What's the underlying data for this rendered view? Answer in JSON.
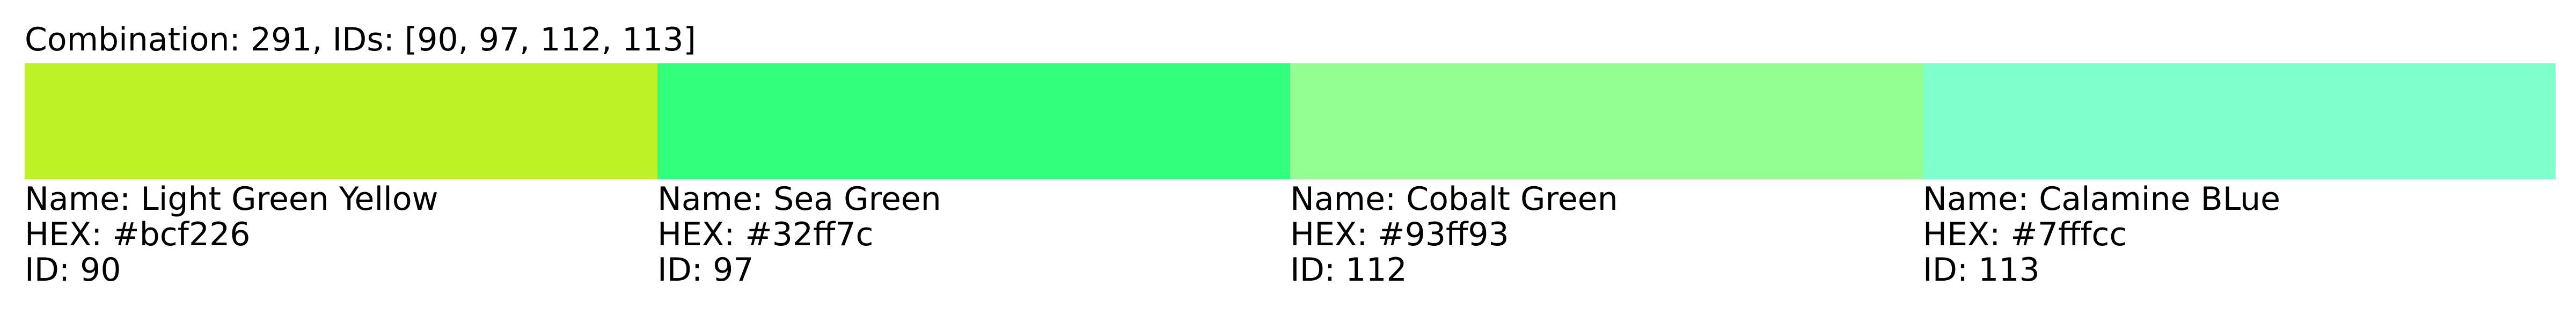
{
  "title": "Combination: 291, IDs: [90, 97, 112, 113]",
  "swatches": [
    {
      "name_line": "Name: Light Green Yellow",
      "hex_line": "HEX: #bcf226",
      "id_line": "ID: 90",
      "color": "#bcf226"
    },
    {
      "name_line": "Name: Sea Green",
      "hex_line": "HEX: #32ff7c",
      "id_line": "ID: 97",
      "color": "#32ff7c"
    },
    {
      "name_line": "Name: Cobalt Green",
      "hex_line": "HEX: #93ff93",
      "id_line": "ID: 112",
      "color": "#93ff93"
    },
    {
      "name_line": "Name: Calamine BLue",
      "hex_line": "HEX: #7fffcc",
      "id_line": "ID: 113",
      "color": "#7fffcc"
    }
  ]
}
